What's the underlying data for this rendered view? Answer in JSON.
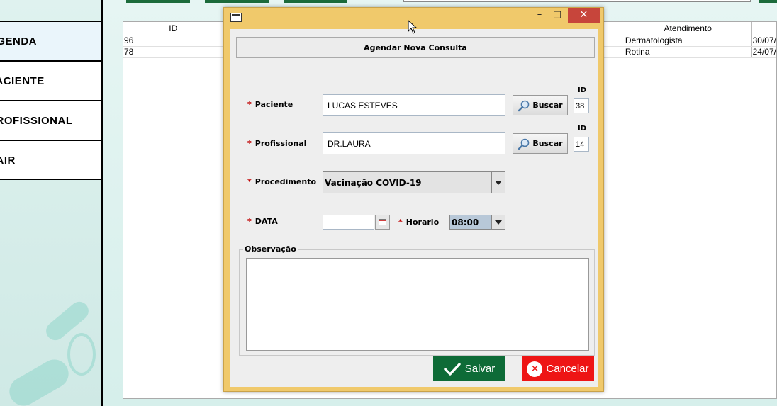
{
  "sidebar": {
    "items": [
      {
        "label": "AGENDA"
      },
      {
        "label": "PACIENTE"
      },
      {
        "label": "PROFISSIONAL"
      },
      {
        "label": "SAIR"
      }
    ]
  },
  "table": {
    "columns": [
      "ID",
      "Atendimento",
      ""
    ],
    "rows": [
      {
        "id": "96",
        "atendimento": "Dermatologista",
        "data": "30/07/"
      },
      {
        "id": "78",
        "atendimento": "Rotina",
        "data": "24/07/"
      }
    ]
  },
  "dialog": {
    "header": "Agendar Nova Consulta",
    "paciente": {
      "label": "Paciente",
      "value": "LUCAS ESTEVES",
      "search_label": "Buscar",
      "id_label": "ID",
      "id_value": "38"
    },
    "profissional": {
      "label": "Profissional",
      "value": "DR.LAURA",
      "search_label": "Buscar",
      "id_label": "ID",
      "id_value": "14"
    },
    "procedimento": {
      "label": "Procedimento",
      "selected": "Vacinação COVID-19"
    },
    "data": {
      "label": "DATA",
      "value": ""
    },
    "horario": {
      "label": "Horario",
      "selected": "08:00"
    },
    "observacao": {
      "label": "Observação",
      "value": ""
    },
    "save_label": "Salvar",
    "cancel_label": "Cancelar",
    "required_mark": "*",
    "window_controls": {
      "minimize": "–",
      "maximize": "□",
      "close": "✕"
    }
  },
  "colors": {
    "dialog_frame": "#f0c96b",
    "save_button": "#0e6b37",
    "cancel_button": "#ee1515",
    "close_button": "#c7453b",
    "required_mark": "#c00000"
  }
}
